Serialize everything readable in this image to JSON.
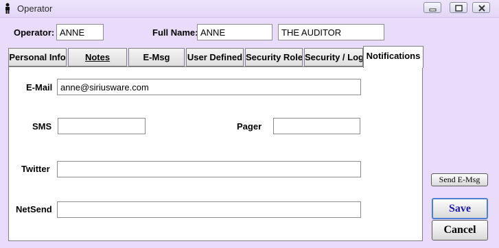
{
  "window": {
    "title": "Operator"
  },
  "header": {
    "operator_label": "Operator:",
    "operator_value": "ANNE",
    "fullname_label": "Full Name:",
    "first_name": "ANNE",
    "last_name": "THE AUDITOR"
  },
  "tabs": [
    {
      "label": "Personal Info"
    },
    {
      "label": "Notes"
    },
    {
      "label": "E-Msg"
    },
    {
      "label": "User Defined"
    },
    {
      "label": "Security Role"
    },
    {
      "label": "Security / Log"
    },
    {
      "label": "Notifications"
    }
  ],
  "active_tab": "Notifications",
  "notifications": {
    "email_label": "E-Mail",
    "email_value": "anne@siriusware.com",
    "sms_label": "SMS",
    "sms_value": "",
    "pager_label": "Pager",
    "pager_value": "",
    "twitter_label": "Twitter",
    "twitter_value": "",
    "netsend_label": "NetSend",
    "netsend_value": ""
  },
  "buttons": {
    "send_emsg": "Send E-Msg",
    "save": "Save",
    "cancel": "Cancel"
  },
  "icons": {
    "app": "person-icon",
    "minimize": "minimize-icon",
    "maximize": "maximize-icon",
    "close": "close-icon"
  }
}
